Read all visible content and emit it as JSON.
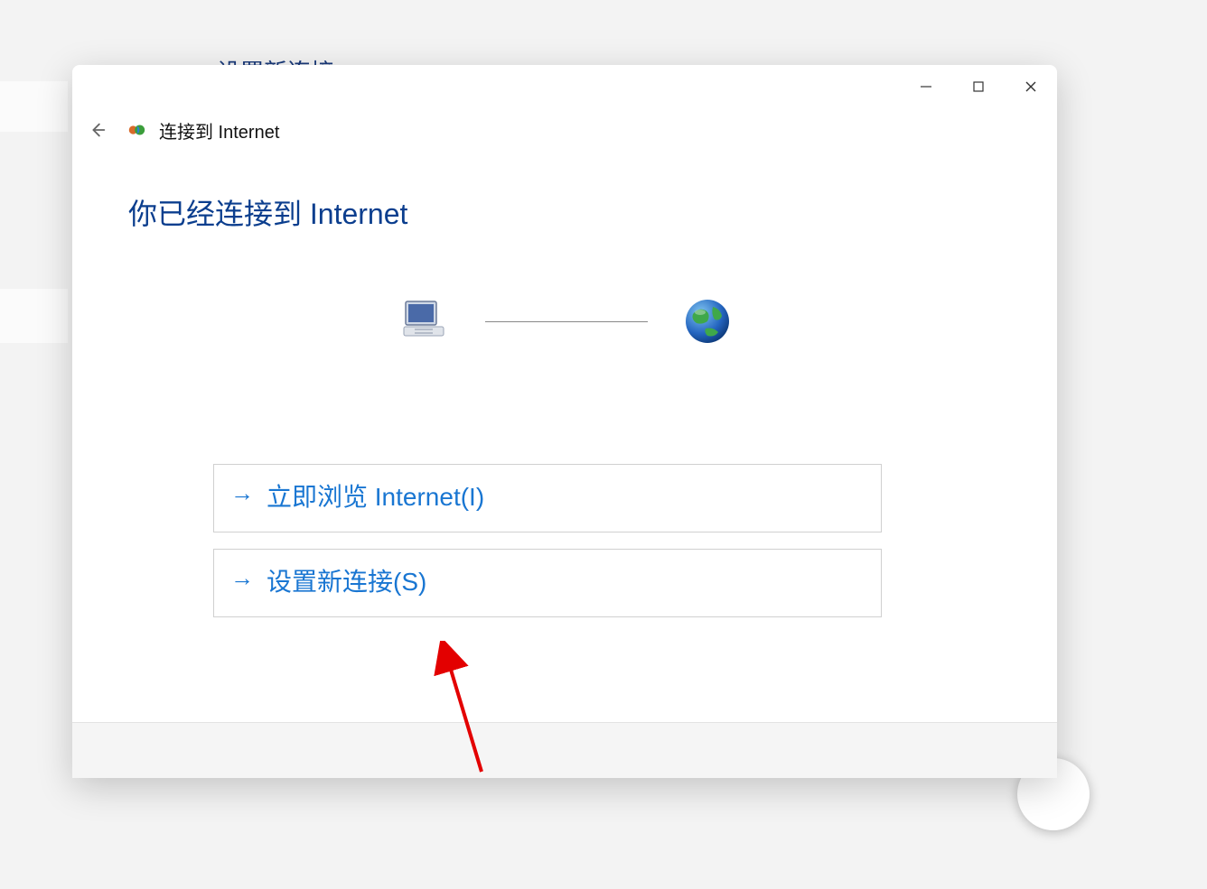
{
  "background": {
    "partial_link": "设置新连接"
  },
  "dialog": {
    "header_title": "连接到 Internet",
    "headline": "你已经连接到 Internet",
    "options": {
      "browse": "立即浏览 Internet(I)",
      "setup_new": "设置新连接(S)"
    }
  }
}
